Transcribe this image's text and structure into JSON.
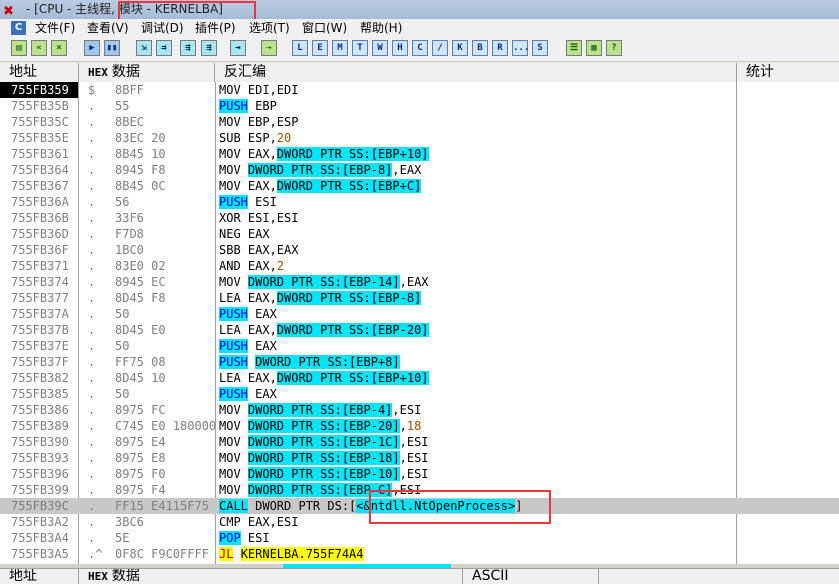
{
  "window": {
    "title": "- [CPU - 主线程, 模块 - KERNELBA]"
  },
  "menu": [
    {
      "label": "文件(F)"
    },
    {
      "label": "查看(V)"
    },
    {
      "label": "调试(D)"
    },
    {
      "label": "插件(P)"
    },
    {
      "label": "选项(T)"
    },
    {
      "label": "窗口(W)"
    },
    {
      "label": "帮助(H)"
    }
  ],
  "toolbar_letters": [
    "L",
    "E",
    "M",
    "T",
    "W",
    "H",
    "C",
    "/",
    "K",
    "B",
    "R",
    "...",
    "S"
  ],
  "columns": {
    "address": "地址",
    "hex_tag": "HEX",
    "data": "数据",
    "disasm": "反汇编",
    "comment": "统计"
  },
  "bottom_columns": {
    "address": "地址",
    "hex_tag": "HEX",
    "data": "数据",
    "ascii": "ASCII"
  },
  "rows": [
    {
      "addr": "755FB359",
      "mark": "$",
      "hex": "8BFF",
      "parts": [
        {
          "t": "MOV EDI,EDI"
        }
      ]
    },
    {
      "addr": "755FB35B",
      "mark": ".",
      "hex": "55",
      "kind": "push",
      "parts": [
        {
          "t": "PUSH",
          "c": "mn"
        },
        {
          "t": " EBP"
        }
      ]
    },
    {
      "addr": "755FB35C",
      "mark": ".",
      "hex": "8BEC",
      "parts": [
        {
          "t": "MOV EBP,ESP"
        }
      ]
    },
    {
      "addr": "755FB35E",
      "mark": ".",
      "hex": "83EC 20",
      "parts": [
        {
          "t": "SUB ESP,"
        },
        {
          "t": "20",
          "c": "seg-num"
        }
      ]
    },
    {
      "addr": "755FB361",
      "mark": ".",
      "hex": "8B45 10",
      "parts": [
        {
          "t": "MOV EAX,"
        },
        {
          "t": "DWORD PTR SS:[EBP+10]",
          "c": "seg-ptr"
        }
      ]
    },
    {
      "addr": "755FB364",
      "mark": ".",
      "hex": "8945 F8",
      "parts": [
        {
          "t": "MOV "
        },
        {
          "t": "DWORD PTR SS:[EBP-8]",
          "c": "seg-ptr"
        },
        {
          "t": ",EAX"
        }
      ]
    },
    {
      "addr": "755FB367",
      "mark": ".",
      "hex": "8B45 0C",
      "parts": [
        {
          "t": "MOV EAX,"
        },
        {
          "t": "DWORD PTR SS:[EBP+C]",
          "c": "seg-ptr"
        }
      ]
    },
    {
      "addr": "755FB36A",
      "mark": ".",
      "hex": "56",
      "kind": "push",
      "parts": [
        {
          "t": "PUSH",
          "c": "mn"
        },
        {
          "t": " ESI"
        }
      ]
    },
    {
      "addr": "755FB36B",
      "mark": ".",
      "hex": "33F6",
      "parts": [
        {
          "t": "XOR ESI,ESI"
        }
      ]
    },
    {
      "addr": "755FB36D",
      "mark": ".",
      "hex": "F7D8",
      "parts": [
        {
          "t": "NEG EAX"
        }
      ]
    },
    {
      "addr": "755FB36F",
      "mark": ".",
      "hex": "1BC0",
      "parts": [
        {
          "t": "SBB EAX,EAX"
        }
      ]
    },
    {
      "addr": "755FB371",
      "mark": ".",
      "hex": "83E0 02",
      "parts": [
        {
          "t": "AND EAX,"
        },
        {
          "t": "2",
          "c": "seg-num"
        }
      ]
    },
    {
      "addr": "755FB374",
      "mark": ".",
      "hex": "8945 EC",
      "parts": [
        {
          "t": "MOV "
        },
        {
          "t": "DWORD PTR SS:[EBP-14]",
          "c": "seg-ptr"
        },
        {
          "t": ",EAX"
        }
      ]
    },
    {
      "addr": "755FB377",
      "mark": ".",
      "hex": "8D45 F8",
      "parts": [
        {
          "t": "LEA EAX,"
        },
        {
          "t": "DWORD PTR SS:[EBP-8]",
          "c": "seg-ptr"
        }
      ]
    },
    {
      "addr": "755FB37A",
      "mark": ".",
      "hex": "50",
      "kind": "push",
      "parts": [
        {
          "t": "PUSH",
          "c": "mn"
        },
        {
          "t": " EAX"
        }
      ]
    },
    {
      "addr": "755FB37B",
      "mark": ".",
      "hex": "8D45 E0",
      "parts": [
        {
          "t": "LEA EAX,"
        },
        {
          "t": "DWORD PTR SS:[EBP-20]",
          "c": "seg-ptr"
        }
      ]
    },
    {
      "addr": "755FB37E",
      "mark": ".",
      "hex": "50",
      "kind": "push",
      "parts": [
        {
          "t": "PUSH",
          "c": "mn"
        },
        {
          "t": " EAX"
        }
      ]
    },
    {
      "addr": "755FB37F",
      "mark": ".",
      "hex": "FF75 08",
      "kind": "push",
      "parts": [
        {
          "t": "PUSH",
          "c": "mn"
        },
        {
          "t": " "
        },
        {
          "t": "DWORD PTR SS:[EBP+8]",
          "c": "seg-ptr"
        }
      ]
    },
    {
      "addr": "755FB382",
      "mark": ".",
      "hex": "8D45 10",
      "parts": [
        {
          "t": "LEA EAX,"
        },
        {
          "t": "DWORD PTR SS:[EBP+10]",
          "c": "seg-ptr"
        }
      ]
    },
    {
      "addr": "755FB385",
      "mark": ".",
      "hex": "50",
      "kind": "push",
      "parts": [
        {
          "t": "PUSH",
          "c": "mn"
        },
        {
          "t": " EAX"
        }
      ]
    },
    {
      "addr": "755FB386",
      "mark": ".",
      "hex": "8975 FC",
      "parts": [
        {
          "t": "MOV "
        },
        {
          "t": "DWORD PTR SS:[EBP-4]",
          "c": "seg-ptr"
        },
        {
          "t": ",ESI"
        }
      ]
    },
    {
      "addr": "755FB389",
      "mark": ".",
      "hex": "C745 E0 1800000",
      "parts": [
        {
          "t": "MOV "
        },
        {
          "t": "DWORD PTR SS:[EBP-20]",
          "c": "seg-ptr"
        },
        {
          "t": ","
        },
        {
          "t": "18",
          "c": "seg-num"
        }
      ]
    },
    {
      "addr": "755FB390",
      "mark": ".",
      "hex": "8975 E4",
      "parts": [
        {
          "t": "MOV "
        },
        {
          "t": "DWORD PTR SS:[EBP-1C]",
          "c": "seg-ptr"
        },
        {
          "t": ",ESI"
        }
      ]
    },
    {
      "addr": "755FB393",
      "mark": ".",
      "hex": "8975 E8",
      "parts": [
        {
          "t": "MOV "
        },
        {
          "t": "DWORD PTR SS:[EBP-18]",
          "c": "seg-ptr"
        },
        {
          "t": ",ESI"
        }
      ]
    },
    {
      "addr": "755FB396",
      "mark": ".",
      "hex": "8975 F0",
      "parts": [
        {
          "t": "MOV "
        },
        {
          "t": "DWORD PTR SS:[EBP-10]",
          "c": "seg-ptr"
        },
        {
          "t": ",ESI"
        }
      ]
    },
    {
      "addr": "755FB399",
      "mark": ".",
      "hex": "8975 F4",
      "parts": [
        {
          "t": "MOV "
        },
        {
          "t": "DWORD PTR SS:[EBP-C]",
          "c": "seg-ptr"
        },
        {
          "t": ",ESI"
        }
      ]
    },
    {
      "addr": "755FB39C",
      "mark": ".",
      "hex": "FF15 E4115F75",
      "kind": "call",
      "current": true,
      "parts": [
        {
          "t": "CALL",
          "c": "mn"
        },
        {
          "t": " DWORD PTR DS:["
        },
        {
          "t": "<&ntdll.NtOpenProcess>",
          "c": "seg-ptr"
        },
        {
          "t": "]"
        }
      ]
    },
    {
      "addr": "755FB3A2",
      "mark": ".",
      "hex": "3BC6",
      "parts": [
        {
          "t": "CMP EAX,ESI"
        }
      ]
    },
    {
      "addr": "755FB3A4",
      "mark": ".",
      "hex": "5E",
      "kind": "push",
      "parts": [
        {
          "t": "POP",
          "c": "mn"
        },
        {
          "t": " ESI"
        }
      ]
    },
    {
      "addr": "755FB3A5",
      "mark": ".^",
      "hex": "0F8C F9C0FFFF",
      "kind": "jl",
      "parts": [
        {
          "t": "JL",
          "c": "mn"
        },
        {
          "t": " "
        },
        {
          "t": "KERNELBA.755F74A4",
          "c": "tgt"
        }
      ]
    }
  ]
}
